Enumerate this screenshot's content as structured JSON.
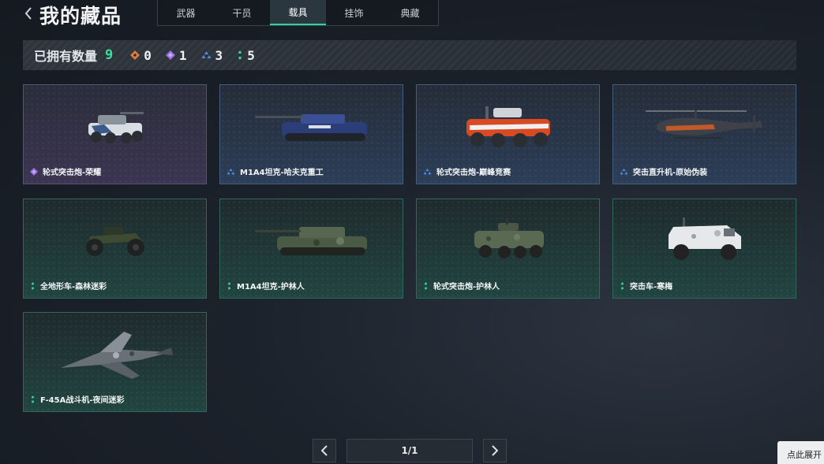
{
  "header": {
    "title": "我的藏品",
    "tabs": [
      {
        "label": "武器",
        "active": false
      },
      {
        "label": "干员",
        "active": false
      },
      {
        "label": "载具",
        "active": true
      },
      {
        "label": "挂饰",
        "active": false
      },
      {
        "label": "典藏",
        "active": false
      }
    ]
  },
  "summary": {
    "label": "已拥有数量",
    "total": "9",
    "rarities": [
      {
        "name": "orange",
        "color": "#e07a3a",
        "count": "0"
      },
      {
        "name": "purple",
        "color": "#9a6ee0",
        "count": "1"
      },
      {
        "name": "blue",
        "color": "#4a90e2",
        "count": "3"
      },
      {
        "name": "green",
        "color": "#2fd3a0",
        "count": "5"
      }
    ]
  },
  "items": [
    {
      "name": "轮式突击炮-荣耀",
      "rarity": "purple",
      "icon": "wheeled-assault-gun"
    },
    {
      "name": "M1A4坦克-哈夫克重工",
      "rarity": "blue",
      "icon": "tank"
    },
    {
      "name": "轮式突击炮-巅峰竞赛",
      "rarity": "blue",
      "icon": "wheeled-assault-gun"
    },
    {
      "name": "突击直升机-原始伪装",
      "rarity": "blue",
      "icon": "helicopter"
    },
    {
      "name": "全地形车-森林迷彩",
      "rarity": "green",
      "icon": "atv"
    },
    {
      "name": "M1A4坦克-护林人",
      "rarity": "green",
      "icon": "tank"
    },
    {
      "name": "轮式突击炮-护林人",
      "rarity": "green",
      "icon": "wheeled-assault-gun"
    },
    {
      "name": "突击车-寒梅",
      "rarity": "green",
      "icon": "assault-vehicle"
    },
    {
      "name": "F-45A战斗机-夜间迷彩",
      "rarity": "green",
      "icon": "fighter-jet"
    }
  ],
  "pagination": {
    "page": "1/1"
  },
  "expand_tab": "点此展开"
}
